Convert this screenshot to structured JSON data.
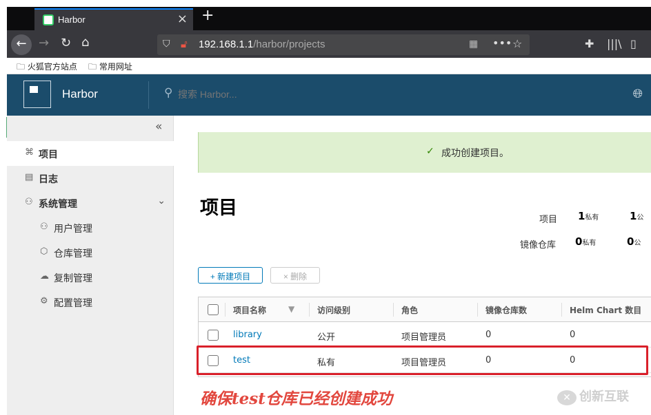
{
  "browser": {
    "tab_title": "Harbor",
    "tab_close": "×",
    "new_tab": "+",
    "url_host": "192.168.1.1",
    "url_path": "/harbor/projects",
    "bookmarks": [
      "火狐官方站点",
      "常用网址"
    ]
  },
  "header": {
    "brand": "Harbor",
    "search_placeholder": "搜索 Harbor..."
  },
  "sidebar": {
    "collapse": "«",
    "items": [
      {
        "label": "项目",
        "icon": "project-icon"
      },
      {
        "label": "日志",
        "icon": "log-icon"
      },
      {
        "label": "系统管理",
        "icon": "admin-icon"
      },
      {
        "label": "用户管理",
        "icon": "users-icon"
      },
      {
        "label": "仓库管理",
        "icon": "registry-icon"
      },
      {
        "label": "复制管理",
        "icon": "replication-icon"
      },
      {
        "label": "配置管理",
        "icon": "config-icon"
      }
    ]
  },
  "alert": {
    "message": "成功创建项目。"
  },
  "main": {
    "title": "项目",
    "stats": {
      "projects_label": "项目",
      "projects_private": "1",
      "projects_private_unit": "私有",
      "projects_public": "1",
      "projects_public_unit": "公",
      "repos_label": "镜像仓库",
      "repos_private": "0",
      "repos_private_unit": "私有",
      "repos_public": "0",
      "repos_public_unit": "公"
    },
    "new_button": "+ 新建项目",
    "delete_button": "× 删除"
  },
  "table": {
    "headers": [
      "项目名称",
      "访问级别",
      "角色",
      "镜像仓库数",
      "Helm Chart 数目"
    ],
    "rows": [
      {
        "name": "library",
        "access": "公开",
        "role": "项目管理员",
        "repos": "0",
        "charts": "0"
      },
      {
        "name": "test",
        "access": "私有",
        "role": "项目管理员",
        "repos": "0",
        "charts": "0"
      }
    ]
  },
  "annotation": {
    "caption": "确保test仓库已经创建成功",
    "watermark": "创新互联"
  },
  "colors": {
    "header_bg": "#1b4c6b",
    "alert_bg": "#dff0d0",
    "link": "#0079b8",
    "highlight": "#d9202a"
  }
}
